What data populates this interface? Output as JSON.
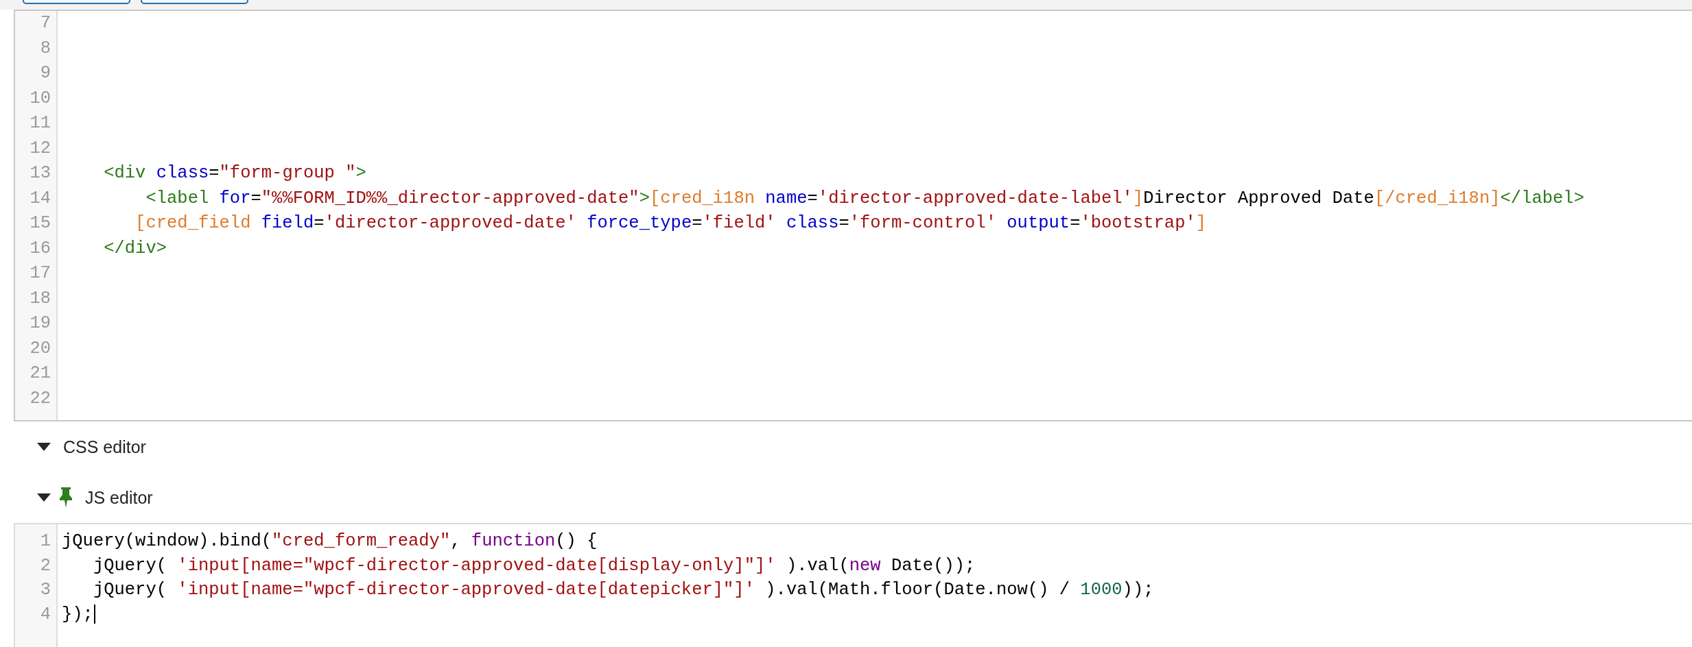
{
  "toolbar": {
    "buttons": [
      {
        "kind": "primary"
      },
      {
        "kind": "primary"
      }
    ]
  },
  "html_editor": {
    "lines": [
      {
        "number": "7"
      },
      {
        "number": "8"
      },
      {
        "number": "9"
      },
      {
        "number": "10"
      },
      {
        "number": "11"
      },
      {
        "number": "12"
      },
      {
        "number": "13",
        "tokens": [
          {
            "kind": "tag",
            "text": "    <div"
          },
          {
            "kind": "attr",
            "text": " class"
          },
          {
            "kind": "plain",
            "text": "="
          },
          {
            "kind": "string",
            "text": "\"form-group \""
          },
          {
            "kind": "tag",
            "text": ">"
          }
        ]
      },
      {
        "number": "14",
        "tokens": [
          {
            "kind": "tag",
            "text": "        <label"
          },
          {
            "kind": "attr",
            "text": " for"
          },
          {
            "kind": "plain",
            "text": "="
          },
          {
            "kind": "string",
            "text": "\"%%FORM_ID%%_director-approved-date\""
          },
          {
            "kind": "tag",
            "text": ">"
          },
          {
            "kind": "shortcode",
            "text": "[cred_i18n"
          },
          {
            "kind": "attr",
            "text": " name"
          },
          {
            "kind": "plain",
            "text": "="
          },
          {
            "kind": "string",
            "text": "'director-approved-date-label'"
          },
          {
            "kind": "shortcode",
            "text": "]"
          },
          {
            "kind": "plain",
            "text": "Director Approved Date"
          },
          {
            "kind": "shortcode",
            "text": "[/cred_i18n]"
          },
          {
            "kind": "tag",
            "text": "</label>"
          }
        ]
      },
      {
        "number": "15",
        "tokens": [
          {
            "kind": "shortcode",
            "text": "       [cred_field"
          },
          {
            "kind": "attr",
            "text": " field"
          },
          {
            "kind": "plain",
            "text": "="
          },
          {
            "kind": "string",
            "text": "'director-approved-date'"
          },
          {
            "kind": "attr",
            "text": " force_type"
          },
          {
            "kind": "plain",
            "text": "="
          },
          {
            "kind": "string",
            "text": "'field'"
          },
          {
            "kind": "attr",
            "text": " class"
          },
          {
            "kind": "plain",
            "text": "="
          },
          {
            "kind": "string",
            "text": "'form-control'"
          },
          {
            "kind": "attr",
            "text": " output"
          },
          {
            "kind": "plain",
            "text": "="
          },
          {
            "kind": "string",
            "text": "'bootstrap'"
          },
          {
            "kind": "shortcode",
            "text": "]"
          }
        ]
      },
      {
        "number": "16",
        "tokens": [
          {
            "kind": "tag",
            "text": "    </div>"
          }
        ]
      },
      {
        "number": "17"
      },
      {
        "number": "18"
      },
      {
        "number": "19"
      },
      {
        "number": "20"
      },
      {
        "number": "21"
      },
      {
        "number": "22"
      }
    ]
  },
  "sections": [
    {
      "title": "CSS editor",
      "pinned": false
    },
    {
      "title": "JS editor",
      "pinned": true
    }
  ],
  "js_editor": {
    "lines": [
      {
        "number": "1",
        "cursor": false,
        "tokens": [
          {
            "kind": "plain",
            "text": "jQuery(window).bind("
          },
          {
            "kind": "string",
            "text": "\"cred_form_ready\""
          },
          {
            "kind": "plain",
            "text": ", "
          },
          {
            "kind": "keyword",
            "text": "function"
          },
          {
            "kind": "plain",
            "text": "() {"
          }
        ]
      },
      {
        "number": "2",
        "cursor": false,
        "tokens": [
          {
            "kind": "plain",
            "text": "   jQuery( "
          },
          {
            "kind": "string",
            "text": "'input[name=\"wpcf-director-approved-date[display-only]\"]'"
          },
          {
            "kind": "plain",
            "text": " ).val("
          },
          {
            "kind": "keyword",
            "text": "new"
          },
          {
            "kind": "plain",
            "text": " Date());"
          }
        ]
      },
      {
        "number": "3",
        "cursor": false,
        "tokens": [
          {
            "kind": "plain",
            "text": "   jQuery( "
          },
          {
            "kind": "string",
            "text": "'input[name=\"wpcf-director-approved-date[datepicker]\"]'"
          },
          {
            "kind": "plain",
            "text": " ).val(Math.floor(Date.now() / "
          },
          {
            "kind": "number",
            "text": "1000"
          },
          {
            "kind": "plain",
            "text": "));"
          }
        ]
      },
      {
        "number": "4",
        "cursor": true,
        "tokens": [
          {
            "kind": "plain",
            "text": "});"
          }
        ]
      }
    ]
  }
}
